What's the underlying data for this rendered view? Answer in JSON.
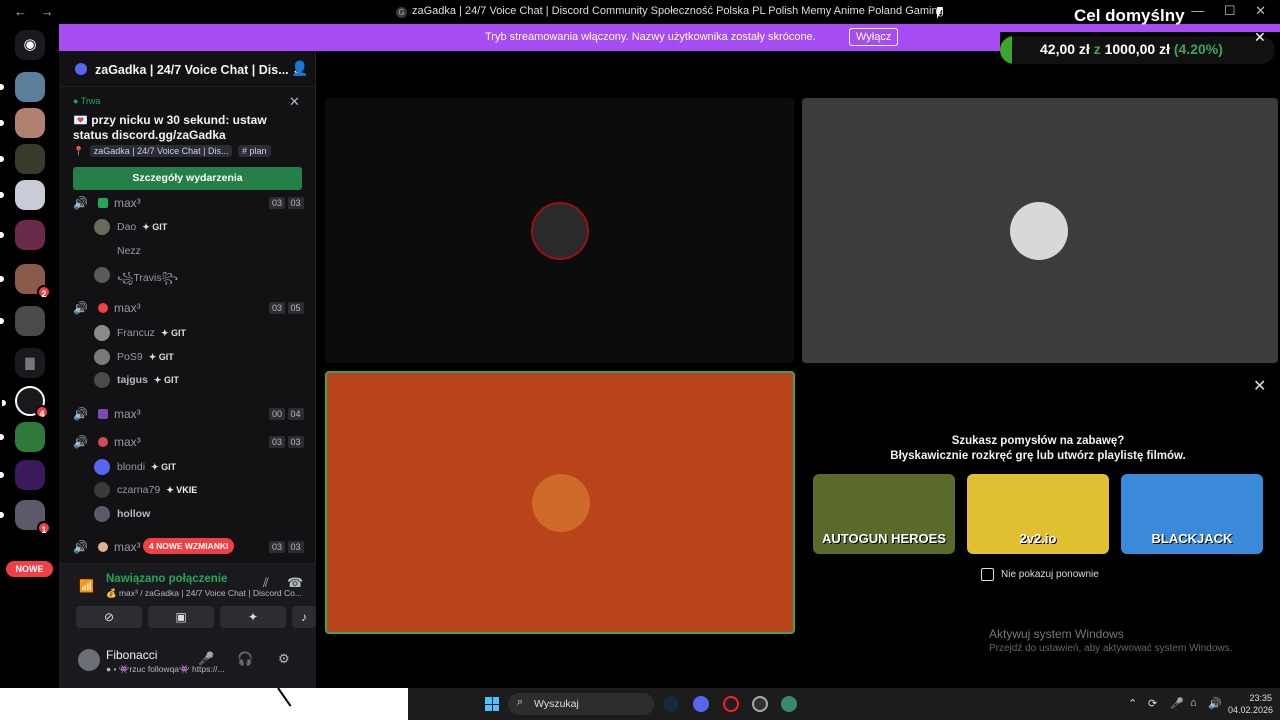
{
  "window": {
    "title": "zaGadka | 24/7 Voice Chat | Discord Community Społeczność Polska PL Polish Memy Anime Poland Gaming",
    "back": "←",
    "forward": "→",
    "minimize": "—",
    "maximize": "☐",
    "close": "✕"
  },
  "goal": {
    "title": "Cel domyślny",
    "current": "42,00 zł",
    "separator": "z",
    "target": "1000,00 zł",
    "percent_text": "(4.20%)",
    "progress_fraction": 0.042,
    "accent": "#3ba55c"
  },
  "banner": {
    "text": "Tryb streamowania włączony. Nazwy użytkownika zostały skrócone.",
    "button": "Wyłącz",
    "close": "✕",
    "color": "#a64cf3"
  },
  "server_list": {
    "nowe_label": "NOWE",
    "badges": [
      "2",
      "4",
      "1"
    ]
  },
  "sidebar": {
    "server_name": "zaGadka | 24/7 Voice Chat | Dis...",
    "event": {
      "status": "● Trwa",
      "title": "💌 przy nicku w 30 sekund: ustaw status discord.gg/zaGadka",
      "location_server": "zaGadka | 24/7 Voice Chat | Dis...",
      "location_channel": "# plan",
      "button": "Szczegóły wydarzenia",
      "close": "✕"
    },
    "channels": [
      {
        "name": "max³",
        "count_a": "03",
        "count_b": "03"
      },
      {
        "name": "max³",
        "count_a": "03",
        "count_b": "05"
      },
      {
        "name": "max³",
        "count_a": "00",
        "count_b": "04"
      },
      {
        "name": "max³",
        "count_a": "03",
        "count_b": "03"
      },
      {
        "name": "max³",
        "count_a": "03",
        "count_b": "03",
        "mention": "4 NOWE WZMIANKI"
      }
    ],
    "members": [
      {
        "name": "Dao",
        "tag": "✦ GIT"
      },
      {
        "name": "Nezz",
        "tag": ""
      },
      {
        "name": "꧁Travis꧂",
        "tag": ""
      },
      {
        "name": "Francuz",
        "tag": "✦ GIT"
      },
      {
        "name": "PoS9",
        "tag": "✦ GIT"
      },
      {
        "name": "tajgus",
        "tag": "✦ GIT"
      },
      {
        "name": "blondi",
        "tag": "✦ GIT"
      },
      {
        "name": "czarna79",
        "tag": "✦ VKIE"
      },
      {
        "name": "hollow",
        "tag": ""
      }
    ],
    "voice": {
      "status": "Nawiązano połączenie",
      "sub": "💰 max³ / zaGadka | 24/7 Voice Chat | Discord Co..."
    },
    "user": {
      "name": "Fibonacci",
      "status": "● • 👾rzuc followqa👾 https://..."
    }
  },
  "activity": {
    "title_line1": "Szukasz pomysłów na zabawę?",
    "title_line2": "Błyskawicznie rozkręć grę lub utwórz playlistę filmów.",
    "games": [
      "AUTOGUN HEROES",
      "2v2.io",
      "BLACKJACK"
    ],
    "checkbox_label": "Nie pokazuj ponownie",
    "close": "✕"
  },
  "windows_activation": {
    "line1": "Aktywuj system Windows",
    "line2": "Przejdź do ustawień, aby aktywować system Windows."
  },
  "taskbar": {
    "search_placeholder": "Wyszukaj",
    "time": "23:35",
    "date": "04.02.2026"
  }
}
